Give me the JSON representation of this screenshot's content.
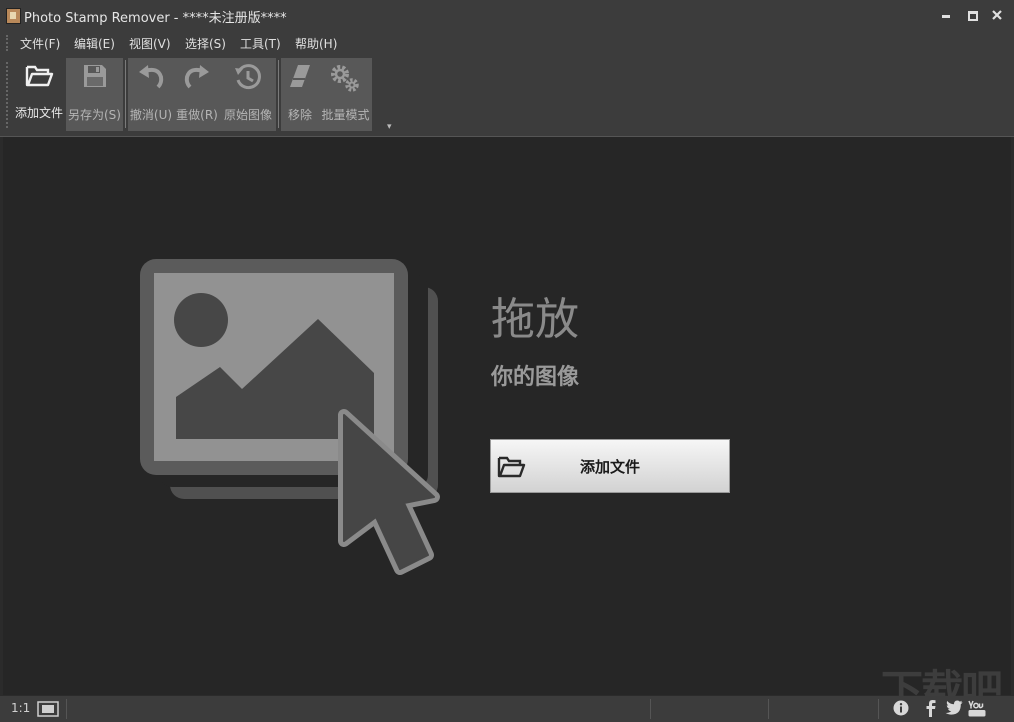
{
  "window": {
    "title": "Photo Stamp Remover - ****未注册版****",
    "controls": [
      "minimize",
      "maximize",
      "close"
    ]
  },
  "menu": {
    "items": [
      {
        "label": "文件(F)"
      },
      {
        "label": "编辑(E)"
      },
      {
        "label": "视图(V)"
      },
      {
        "label": "选择(S)"
      },
      {
        "label": "工具(T)"
      },
      {
        "label": "帮助(H)"
      }
    ]
  },
  "toolbar": {
    "add_file": {
      "label": "添加文件",
      "icon": "folder-open-icon",
      "enabled": true
    },
    "save_as": {
      "label": "另存为(S)",
      "icon": "floppy-disk-icon",
      "enabled": false
    },
    "undo": {
      "label": "撤消(U)",
      "icon": "undo-icon",
      "enabled": false
    },
    "redo": {
      "label": "重做(R)",
      "icon": "redo-icon",
      "enabled": false
    },
    "original": {
      "label": "原始图像",
      "icon": "history-clock-icon",
      "enabled": false
    },
    "remove": {
      "label": "移除",
      "icon": "eraser-icon",
      "enabled": false
    },
    "batch": {
      "label": "批量模式",
      "icon": "gears-icon",
      "enabled": false
    },
    "overflow": "▾"
  },
  "main": {
    "drag_title": "拖放",
    "drag_subtitle": "你的图像",
    "add_button": {
      "label": "添加文件",
      "icon": "folder-open-icon"
    }
  },
  "watermark": "下载吧",
  "statusbar": {
    "zoom": "1:1",
    "fit_icon": "fit-to-window-icon",
    "social_icons": [
      "info-icon",
      "facebook-icon",
      "twitter-icon",
      "youtube-icon"
    ]
  },
  "colors": {
    "chrome": "#3c3c3c",
    "canvas": "#262626",
    "toolbar_group": "#585858",
    "button_gradient_top": "#f6f6f6",
    "button_gradient_bottom": "#d2d2d2"
  }
}
